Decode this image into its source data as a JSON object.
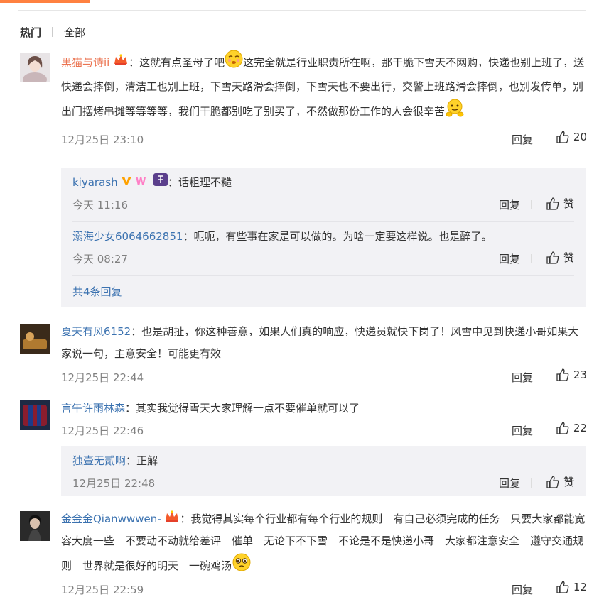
{
  "tabs": {
    "hot": "热门",
    "all": "全部"
  },
  "comments": [
    {
      "user": "黑猫与诗ii",
      "text_a": "：这就有点圣母了吧",
      "text_b": "这完全就是行业职责所在啊，那干脆下雪天不网购，快递也别上班了，送快递会摔倒，清洁工也别上班，下雪天路滑会摔倒，下雪天也不要出行，交警上班路滑会摔倒，也别发传单，别出门摆烤串摊等等等等，我们干脆都别吃了别买了，不然做那份工作的人会很辛苦",
      "time": "12月25日 23:10",
      "reply": "回复",
      "likes": "20",
      "subs": [
        {
          "user": "kiyarash",
          "text": "：话粗理不糙",
          "time": "今天 11:16",
          "reply": "回复",
          "like": "赞"
        },
        {
          "user": "溺海少女6064662851",
          "text": "：呃呃，有些事在家是可以做的。为啥一定要这样说。也是醉了。",
          "time": "今天 08:27",
          "reply": "回复",
          "like": "赞"
        }
      ],
      "more": "共4条回复"
    },
    {
      "user": "夏天有风6152",
      "text": "：也是胡扯，你这种善意，如果人们真的响应，快递员就快下岗了！风雪中见到快递小哥如果大家说一句，主意安全！可能更有效",
      "time": "12月25日 22:44",
      "reply": "回复",
      "likes": "23"
    },
    {
      "user": "言午许雨林森",
      "text": "：其实我觉得雪天大家理解一点不要催单就可以了",
      "time": "12月25日 22:46",
      "reply": "回复",
      "likes": "22",
      "subs": [
        {
          "user": "独壹无贰啊",
          "text": "：正解",
          "time": "12月25日 22:48",
          "reply": "回复",
          "like": "赞"
        }
      ]
    },
    {
      "user": "金金金Qianwwwen-",
      "text": "：我觉得其实每个行业都有每个行业的规则　有自己必须完成的任务　只要大家都能宽容大度一些　不要动不动就给差评　催单　无论下不下雪　不论是不是快递小哥　大家都注意安全　遵守交通规则　世界就是很好的明天　一碗鸡汤",
      "time": "12月25日 22:59",
      "reply": "回复",
      "likes": "12"
    }
  ],
  "colors": {
    "accent": "#ff8140",
    "link": "#3b72b0",
    "vip_name": "#eb7350",
    "sub_bg": "#f2f2f5"
  }
}
